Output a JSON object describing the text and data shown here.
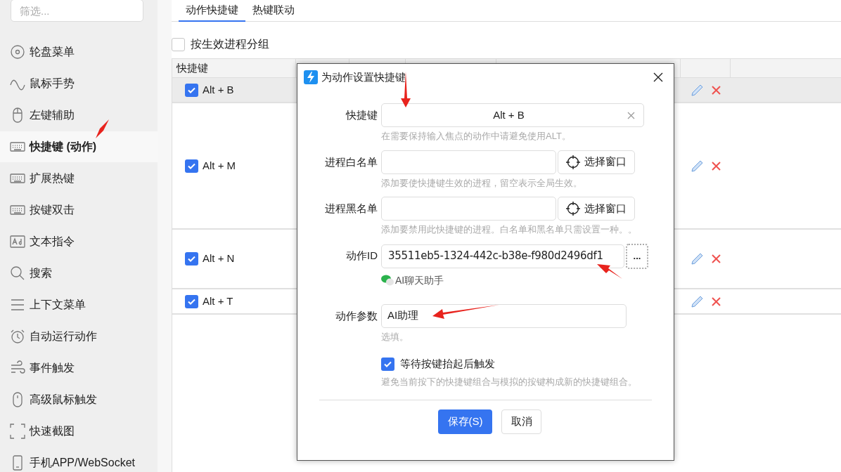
{
  "sidebar": {
    "filter": {
      "placeholder": "筛选..."
    },
    "items": [
      {
        "label": "轮盘菜单",
        "selected": false
      },
      {
        "label": "鼠标手势",
        "selected": false
      },
      {
        "label": "左键辅助",
        "selected": false
      },
      {
        "label": "快捷键 (动作)",
        "selected": true
      },
      {
        "label": "扩展热键",
        "selected": false
      },
      {
        "label": "按键双击",
        "selected": false
      },
      {
        "label": "文本指令",
        "selected": false
      },
      {
        "label": "搜索",
        "selected": false
      },
      {
        "label": "上下文菜单",
        "selected": false
      },
      {
        "label": "自动运行动作",
        "selected": false
      },
      {
        "label": "事件触发",
        "selected": false
      },
      {
        "label": "高级鼠标触发",
        "selected": false
      },
      {
        "label": "快速截图",
        "selected": false
      },
      {
        "label": "手机APP/WebSocket",
        "selected": false
      }
    ]
  },
  "tabs": [
    {
      "label": "动作快捷键",
      "selected": true
    },
    {
      "label": "热键联动",
      "selected": false
    }
  ],
  "group_by_process": {
    "label": "按生效进程分组",
    "checked": false
  },
  "table": {
    "columns": [
      "快捷键"
    ],
    "rows": [
      {
        "hotkey": "Alt + B",
        "checked": true,
        "selected": true
      },
      {
        "hotkey": "Alt + M",
        "checked": true,
        "selected": false
      },
      {
        "hotkey": "Alt + N",
        "checked": true,
        "selected": false
      },
      {
        "hotkey": "Alt + T",
        "checked": true,
        "selected": false
      }
    ]
  },
  "dialog": {
    "title": "为动作设置快捷键",
    "fields": [
      {
        "kind": "hotkey",
        "label": "快捷键",
        "value": "Alt + B",
        "hint": "在需要保持输入焦点的动作中请避免使用ALT。"
      },
      {
        "kind": "picker",
        "label": "进程白名单",
        "button": "选择窗口",
        "hint": "添加要使快捷键生效的进程，留空表示全局生效。"
      },
      {
        "kind": "picker",
        "label": "进程黑名单",
        "button": "选择窗口",
        "hint": "添加要禁用此快捷键的进程。白名单和黑名单只需设置一种。。"
      },
      {
        "kind": "action",
        "label": "动作ID",
        "value": "35511eb5-1324-442c-b38e-f980d2496df1",
        "button": "...",
        "action_name": "AI聊天助手"
      },
      {
        "kind": "text",
        "label": "动作参数",
        "value": "AI助理",
        "hint": "选填。"
      }
    ],
    "wait_release": {
      "label": "等待按键抬起后触发",
      "checked": true,
      "hint": "避免当前按下的快捷键组合与模拟的按键构成新的快捷键组合。"
    },
    "buttons": [
      {
        "label": "保存(S)",
        "kind": "primary"
      },
      {
        "label": "取消",
        "kind": "secondary"
      }
    ]
  }
}
